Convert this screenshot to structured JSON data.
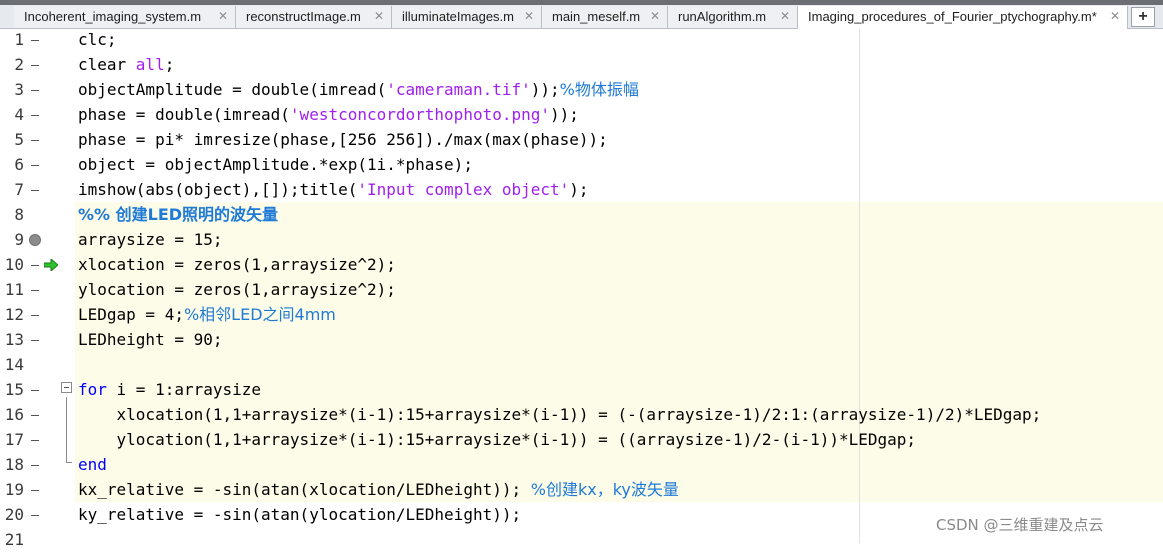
{
  "tabs": [
    {
      "label": "Incoherent_imaging_system.m",
      "active": false
    },
    {
      "label": "reconstructImage.m",
      "active": false
    },
    {
      "label": "illuminateImages.m",
      "active": false
    },
    {
      "label": "main_meself.m",
      "active": false
    },
    {
      "label": "runAlgorithm.m",
      "active": false
    },
    {
      "label": "Imaging_procedures_of_Fourier_ptychography.m*",
      "active": true
    }
  ],
  "close_glyph": "✕",
  "new_tab_glyph": "+",
  "line_numbers": [
    "1",
    "2",
    "3",
    "4",
    "5",
    "6",
    "7",
    "8",
    "9",
    "10",
    "11",
    "12",
    "13",
    "14",
    "15",
    "16",
    "17",
    "18",
    "19",
    "20",
    "21"
  ],
  "code": {
    "l1": "clc;",
    "l2a": "clear ",
    "l2b": "all",
    "l2c": ";",
    "l3a": "objectAmplitude = double(imread(",
    "l3b": "'cameraman.tif'",
    "l3c": "));",
    "l3d": "%物体振幅",
    "l4a": "phase = double(imread(",
    "l4b": "'westconcordorthophoto.png'",
    "l4c": "));",
    "l5": "phase = pi* imresize(phase,[256 256])./max(max(phase));",
    "l6": "object = objectAmplitude.*exp(1i.*phase);",
    "l7a": "imshow(abs(object),[]);title(",
    "l7b": "'Input complex object'",
    "l7c": ");",
    "l8": "%% 创建LED照明的波矢量",
    "l9": "arraysize = 15;",
    "l10": "xlocation = zeros(1,arraysize^2);",
    "l11": "ylocation = zeros(1,arraysize^2);",
    "l12a": "LEDgap = 4;",
    "l12b": "%相邻LED之间4mm",
    "l13": "LEDheight = 90;",
    "l15a": "for",
    "l15b": " i = 1:arraysize",
    "l16": "    xlocation(1,1+arraysize*(i-1):15+arraysize*(i-1)) = (-(arraysize-1)/2:1:(arraysize-1)/2)*LEDgap;",
    "l17": "    ylocation(1,1+arraysize*(i-1):15+arraysize*(i-1)) = ((arraysize-1)/2-(i-1))*LEDgap;",
    "l18": "end",
    "l19a": "kx_relative = -sin(atan(xlocation/LEDheight)); ",
    "l19b": "%创建kx，ky波矢量",
    "l20": "ky_relative = -sin(atan(ylocation/LEDheight));"
  },
  "watermark": "CSDN @三维重建及点云",
  "colors": {
    "keyword": "#0000ff",
    "string": "#a020f0",
    "comment": "#228b22",
    "cell_highlight": "#fcfce8"
  }
}
